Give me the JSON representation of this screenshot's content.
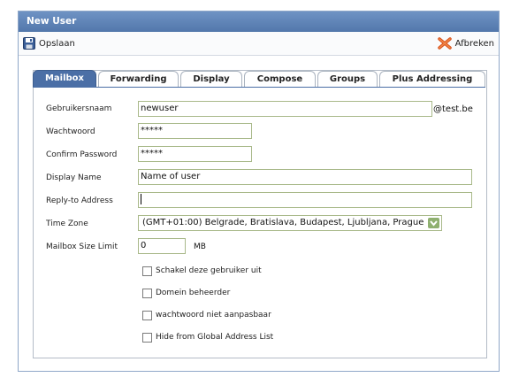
{
  "window": {
    "title": "New User"
  },
  "toolbar": {
    "save_label": "Opslaan",
    "cancel_label": "Afbreken"
  },
  "tabs": [
    "Mailbox",
    "Forwarding",
    "Display",
    "Compose",
    "Groups",
    "Plus Addressing"
  ],
  "active_tab": "Mailbox",
  "form": {
    "username": {
      "label": "Gebruikersnaam",
      "value": "newuser",
      "suffix": "@test.be"
    },
    "password": {
      "label": "Wachtwoord",
      "value": "*****"
    },
    "confirm_password": {
      "label": "Confirm Password",
      "value": "*****"
    },
    "display_name": {
      "label": "Display Name",
      "value": "Name of user"
    },
    "reply_to": {
      "label": "Reply-to Address",
      "value": ""
    },
    "time_zone": {
      "label": "Time Zone",
      "value": "(GMT+01:00) Belgrade, Bratislava, Budapest, Ljubljana, Prague"
    },
    "mailbox_limit": {
      "label": "Mailbox Size Limit",
      "value": "0",
      "unit": "MB"
    },
    "checkboxes": [
      {
        "label": "Schakel deze gebruiker uit",
        "checked": false
      },
      {
        "label": "Domein beheerder",
        "checked": false
      },
      {
        "label": "wachtwoord niet aanpasbaar",
        "checked": false
      },
      {
        "label": "Hide from Global Address List",
        "checked": false
      }
    ]
  },
  "colors": {
    "titlebar": "#5a7fb4",
    "active_tab": "#4b6fa6",
    "input_border": "#a9b98a"
  }
}
